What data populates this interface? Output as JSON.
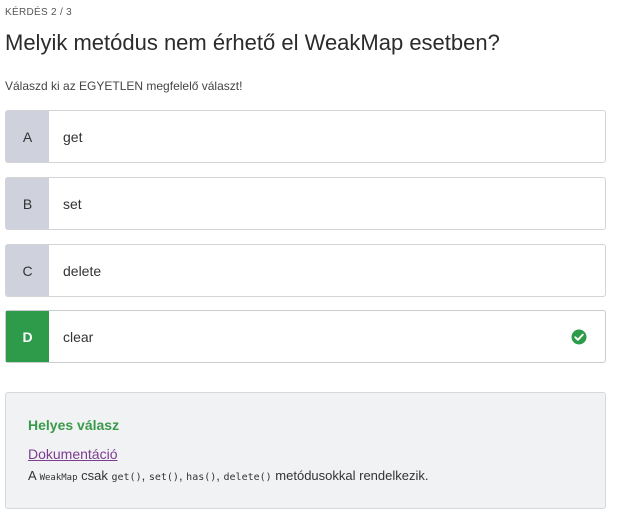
{
  "question": {
    "counter": "KÉRDÉS 2 / 3",
    "title": "Melyik metódus nem érhető el WeakMap esetben?",
    "instruction": "Válaszd ki az EGYETLEN megfelelő választ!"
  },
  "options": [
    {
      "letter": "A",
      "text": "get"
    },
    {
      "letter": "B",
      "text": "set"
    },
    {
      "letter": "C",
      "text": "delete"
    },
    {
      "letter": "D",
      "text": "clear"
    }
  ],
  "feedback": {
    "title": "Helyes válasz",
    "link": "Dokumentáció",
    "explanation": {
      "prefix": "A ",
      "code1": "WeakMap",
      "mid1": " csak ",
      "code2": "get()",
      "sep1": ", ",
      "code3": "set()",
      "sep2": ", ",
      "code4": "has()",
      "sep3": ", ",
      "code5": "delete()",
      "suffix": " metódusokkal rendelkezik."
    }
  },
  "colors": {
    "correct": "#2e9b4a",
    "letter_bg": "#cfd2dc",
    "link": "#7b3d8f"
  },
  "icons": {
    "correct_mark": "check-circle-icon"
  }
}
